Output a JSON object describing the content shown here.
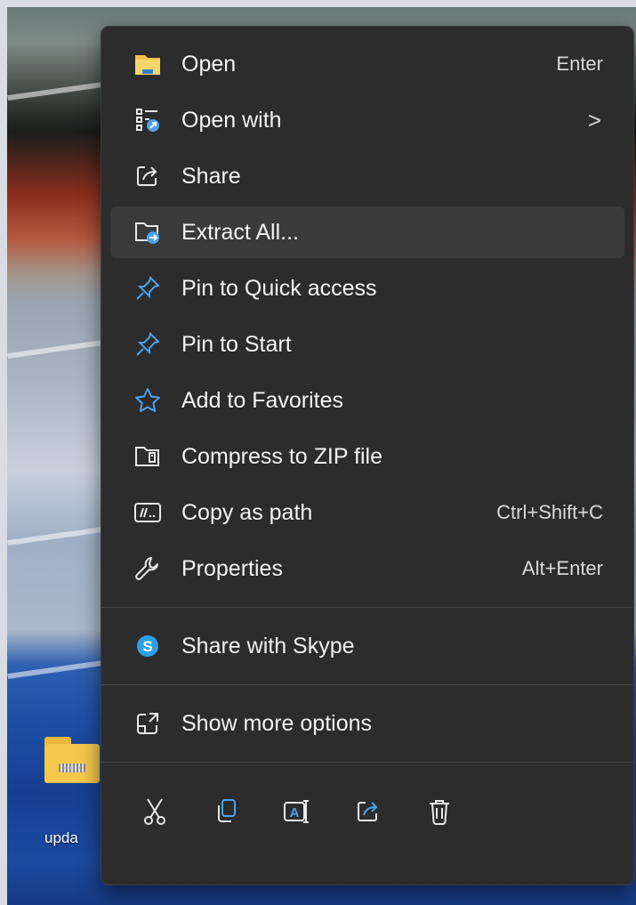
{
  "desktop": {
    "icon_label": "upda"
  },
  "menu": {
    "items": [
      {
        "label": "Open",
        "shortcut": "Enter",
        "icon": "folder-icon"
      },
      {
        "label": "Open with",
        "submenu": ">",
        "icon": "open-with-icon"
      },
      {
        "label": "Share",
        "icon": "share-icon"
      },
      {
        "label": "Extract All...",
        "icon": "extract-icon",
        "highlighted": true
      },
      {
        "label": "Pin to Quick access",
        "icon": "pin-icon"
      },
      {
        "label": "Pin to Start",
        "icon": "pin-icon"
      },
      {
        "label": "Add to Favorites",
        "icon": "star-icon"
      },
      {
        "label": "Compress to ZIP file",
        "icon": "zip-icon"
      },
      {
        "label": "Copy as path",
        "shortcut": "Ctrl+Shift+C",
        "icon": "copy-path-icon"
      },
      {
        "label": "Properties",
        "shortcut": "Alt+Enter",
        "icon": "wrench-icon"
      }
    ],
    "skype_item": {
      "label": "Share with Skype",
      "icon": "skype-icon"
    },
    "more_item": {
      "label": "Show more options",
      "icon": "show-more-icon"
    },
    "toolbar": [
      "cut-icon",
      "copy-icon",
      "rename-icon",
      "share-icon",
      "delete-icon"
    ]
  },
  "colors": {
    "menu_bg": "#2c2c2c",
    "hover_bg": "#3a3a3a",
    "accent": "#4aa3f0",
    "text": "#f2f2f2"
  }
}
